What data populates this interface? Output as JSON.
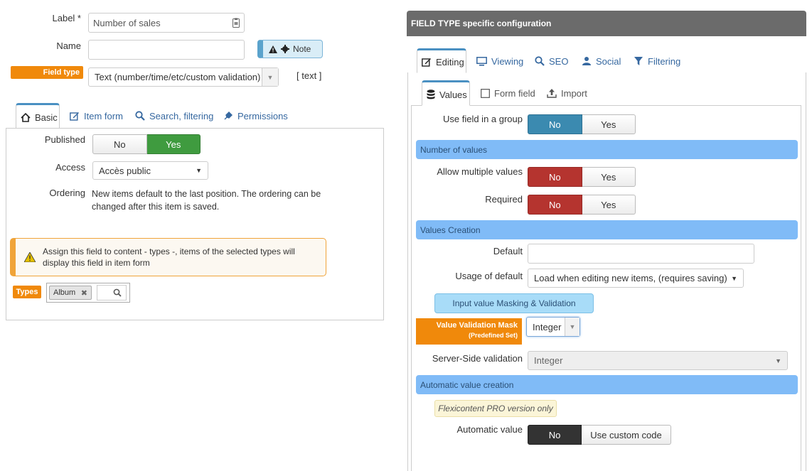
{
  "left": {
    "label_field": {
      "label": "Label *",
      "value": "Number of sales"
    },
    "name_field": {
      "label": "Name",
      "value": ""
    },
    "note_button": "Note",
    "field_type": {
      "badge": "Field type",
      "selected": "Text (number/time/etc/custom validation)",
      "code": "[ text ]"
    },
    "tabs": [
      "Basic",
      "Item form",
      "Search, filtering",
      "Permissions"
    ],
    "published": {
      "label": "Published",
      "no": "No",
      "yes": "Yes",
      "selected": "Yes"
    },
    "access": {
      "label": "Access",
      "selected": "Accès public"
    },
    "ordering": {
      "label": "Ordering",
      "text": "New items default to the last position. The ordering can be changed after this item is saved."
    },
    "warning": "Assign this field to content - types -, items of the selected types will display this field in item form",
    "types": {
      "badge": "Types",
      "tag": "Album"
    }
  },
  "right": {
    "header": "FIELD TYPE specific configuration",
    "tabs": [
      "Editing",
      "Viewing",
      "SEO",
      "Social",
      "Filtering"
    ],
    "subtabs": [
      "Values",
      "Form field",
      "Import"
    ],
    "use_in_group": {
      "label": "Use field in a group",
      "no": "No",
      "yes": "Yes",
      "selected": "No"
    },
    "section_number": "Number of values",
    "allow_multiple": {
      "label": "Allow multiple values",
      "no": "No",
      "yes": "Yes",
      "selected": "No"
    },
    "required": {
      "label": "Required",
      "no": "No",
      "yes": "Yes",
      "selected": "No"
    },
    "section_creation": "Values Creation",
    "default_field": {
      "label": "Default",
      "value": ""
    },
    "usage_default": {
      "label": "Usage of default",
      "selected": "Load when editing new items, (requires saving)"
    },
    "masking_button": "Input value Masking & Validation",
    "validation_mask": {
      "badge_line1": "Value Validation Mask",
      "badge_line2": "(Predefined Set)",
      "selected": "Integer"
    },
    "server_validation": {
      "label": "Server-Side validation",
      "selected": "Integer"
    },
    "section_auto": "Automatic value creation",
    "pro_note": "Flexicontent PRO version only",
    "automatic_value": {
      "label": "Automatic value",
      "no": "No",
      "custom": "Use custom code",
      "selected": "No"
    }
  },
  "colors": {
    "accent_orange": "#f0890b",
    "blue_section": "#80bbf7",
    "green_on": "#3f9b3f",
    "red_on": "#b5342f",
    "header_gray": "#6b6b6b"
  }
}
